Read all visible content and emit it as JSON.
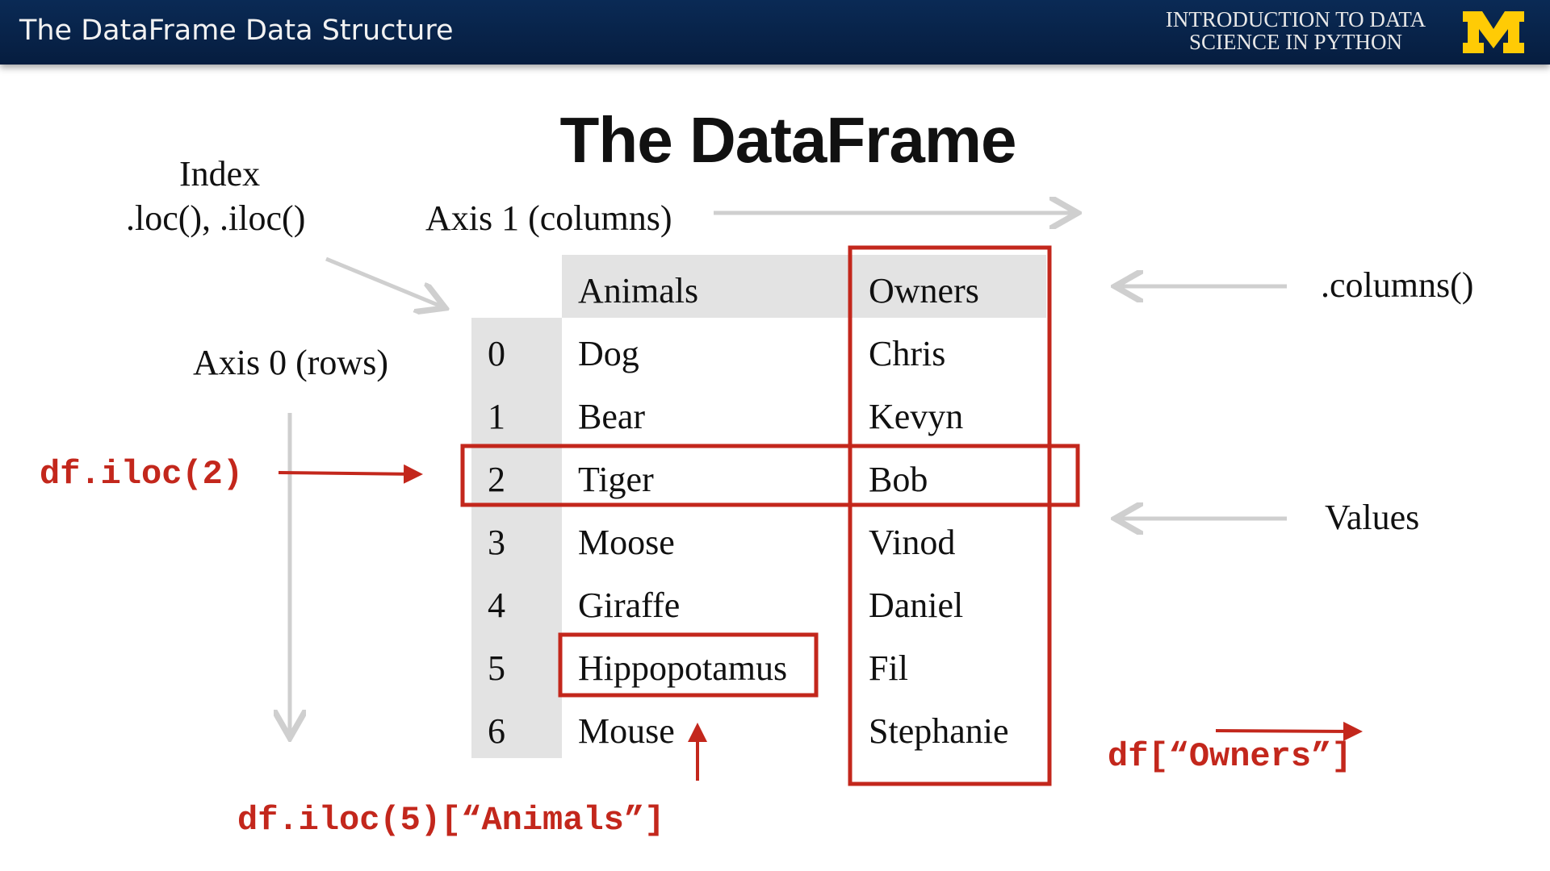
{
  "header": {
    "title": "The DataFrame Data Structure",
    "course_line1": "INTRODUCTION TO DATA",
    "course_line2": "SCIENCE  IN PYTHON",
    "logo": "block-M",
    "logo_color": "#ffcb05"
  },
  "slide": {
    "title": "The DataFrame",
    "index_label": "Index",
    "index_methods": ".loc(), .iloc()",
    "axis1_label": "Axis 1 (columns)",
    "axis0_label": "Axis 0 (rows)",
    "columns_label": ".columns()",
    "values_label": "Values",
    "code_row": "df.iloc(2)",
    "code_column": "df[“Owners”]",
    "code_cell": "df.iloc(5)[“Animals”]",
    "highlight_color": "#c3271c"
  },
  "table": {
    "columns": [
      "Animals",
      "Owners"
    ],
    "rows": [
      {
        "index": "0",
        "animal": "Dog",
        "owner": "Chris"
      },
      {
        "index": "1",
        "animal": "Bear",
        "owner": "Kevyn"
      },
      {
        "index": "2",
        "animal": "Tiger",
        "owner": "Bob"
      },
      {
        "index": "3",
        "animal": "Moose",
        "owner": "Vinod"
      },
      {
        "index": "4",
        "animal": "Giraffe",
        "owner": "Daniel"
      },
      {
        "index": "5",
        "animal": "Hippopotamus",
        "owner": "Fil"
      },
      {
        "index": "6",
        "animal": "Mouse",
        "owner": "Stephanie"
      }
    ]
  }
}
